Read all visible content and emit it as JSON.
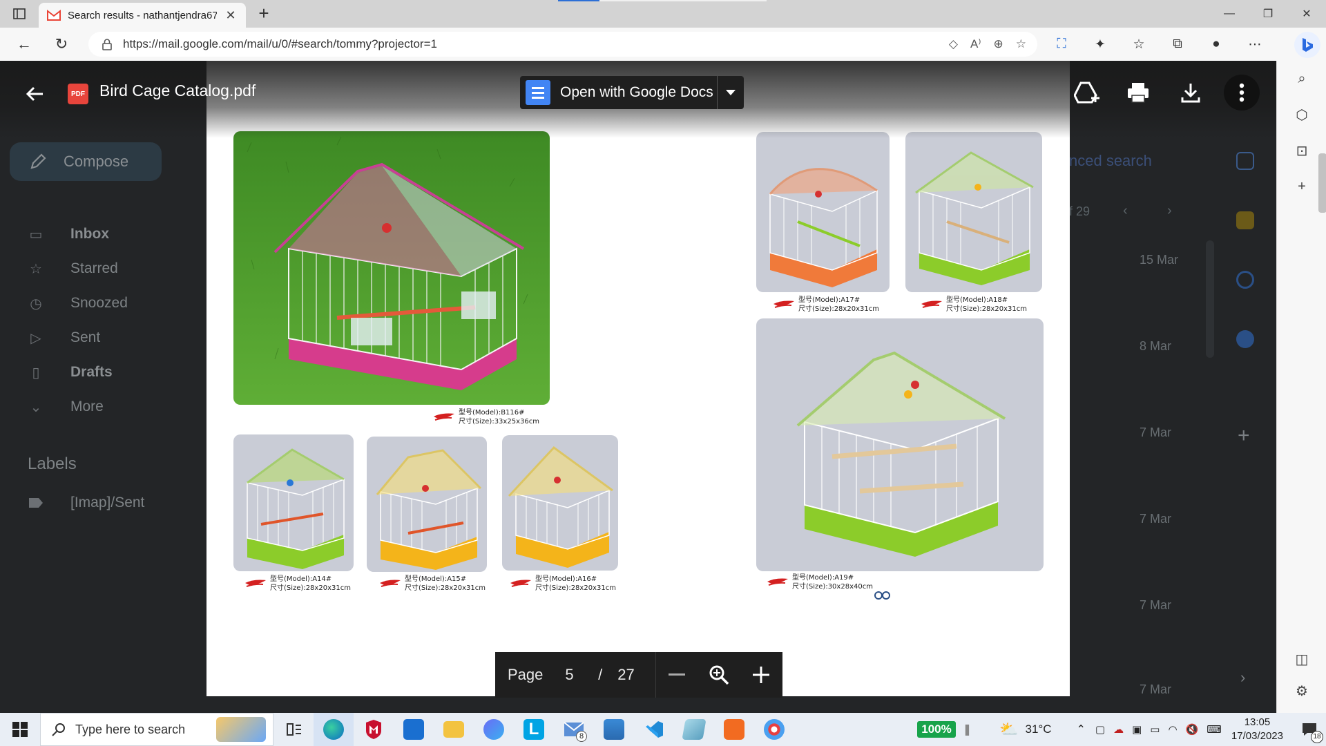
{
  "browser": {
    "tab_title": "Search results - nathantjendra67",
    "url": "https://mail.google.com/mail/u/0/#search/tommy?projector=1"
  },
  "gmail": {
    "compose_label": "Compose",
    "nav": [
      {
        "label": "Inbox",
        "icon": "inbox-icon",
        "bold": true
      },
      {
        "label": "Starred",
        "icon": "star-icon",
        "bold": false
      },
      {
        "label": "Snoozed",
        "icon": "clock-icon",
        "bold": false
      },
      {
        "label": "Sent",
        "icon": "send-icon",
        "bold": false
      },
      {
        "label": "Drafts",
        "icon": "draft-icon",
        "bold": true
      },
      {
        "label": "More",
        "icon": "chevron-down-icon",
        "bold": false
      }
    ],
    "labels_title": "Labels",
    "label_item": "[Imap]/Sent",
    "advanced_search": "nced search",
    "count_text": "f 29",
    "dates": [
      "15 Mar",
      "8 Mar",
      "7 Mar",
      "7 Mar",
      "7 Mar",
      "7 Mar"
    ]
  },
  "viewer": {
    "file_title": "Bird Cage Catalog.pdf",
    "file_badge": "PDF",
    "open_with_label": "Open with Google Docs",
    "page_label": "Page",
    "current_page": "5",
    "page_separator": "/",
    "total_pages": "27"
  },
  "catalog": {
    "b116": {
      "model": "型号(Model):B116#",
      "size": "尺寸(Size):33x25x36cm"
    },
    "a14": {
      "model": "型号(Model):A14#",
      "size": "尺寸(Size):28x20x31cm"
    },
    "a15": {
      "model": "型号(Model):A15#",
      "size": "尺寸(Size):28x20x31cm"
    },
    "a16": {
      "model": "型号(Model):A16#",
      "size": "尺寸(Size):28x20x31cm"
    },
    "a17": {
      "model": "型号(Model):A17#",
      "size": "尺寸(Size):28x20x31cm"
    },
    "a18": {
      "model": "型号(Model):A18#",
      "size": "尺寸(Size):28x20x31cm"
    },
    "a19": {
      "model": "型号(Model):A19#",
      "size": "尺寸(Size):30x28x40cm"
    }
  },
  "taskbar": {
    "search_placeholder": "Type here to search",
    "battery": "100%",
    "weather": "31°C",
    "time": "13:05",
    "date": "17/03/2023",
    "mail_badge": "8",
    "notification_count": "18"
  },
  "colors": {
    "pdf_red": "#e8453c",
    "docs_blue": "#4285f4",
    "grass": "#4f9a2e",
    "cage_pink": "#d63c8c",
    "cage_green": "#8ccc2a",
    "cage_yellow": "#f4b41a",
    "cage_orange": "#f07a3a"
  }
}
